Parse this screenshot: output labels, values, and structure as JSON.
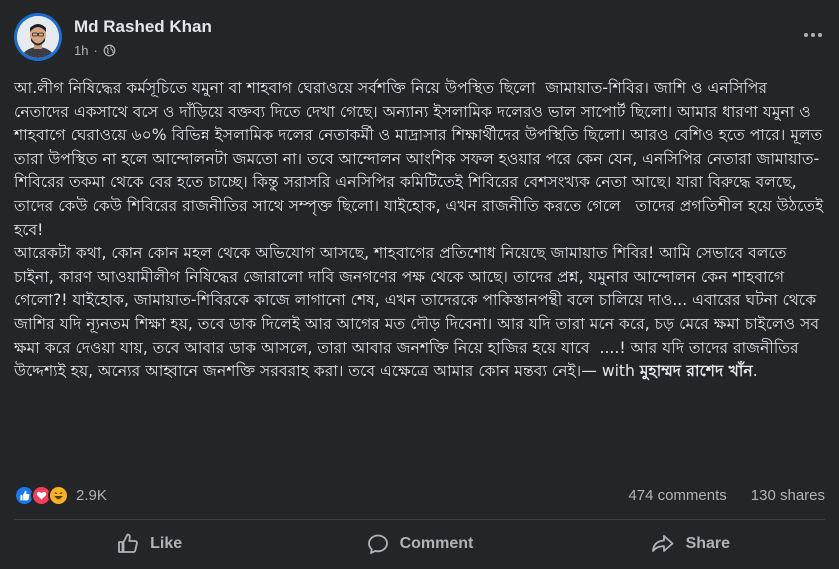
{
  "post": {
    "author": "Md Rashed Khan",
    "time": "1h",
    "separator": "·",
    "paragraphs": [
      "আ.লীগ নিষিদ্ধের কর্মসূচিতে যমুনা বা শাহবাগ ঘেরাওয়ে সর্বশক্তি নিয়ে উপস্থিত ছিলো  জামায়াত-শিবির। জাশি ও এনসিপির নেতাদের একসাথে বসে ও দাঁড়িয়ে বক্তব্য দিতে দেখা গেছে। অন্যান্য ইসলামিক দলেরও ভাল সাপোর্ট ছিলো। আমার ধারণা যমুনা ও শাহবাগে ঘেরাওয়ে ৬০% বিভিন্ন ইসলামিক দলের নেতাকর্মী ও মাদ্রাসার শিক্ষার্থীদের উপস্থিতি ছিলো। আরও বেশিও হতে পারে। মূলত তারা উপস্থিত না হলে আন্দোলনটা জমতো না। তবে আন্দোলন আংশিক সফল হওয়ার পরে কেন যেন, এনসিপির নেতারা জামায়াত-শিবিরের তকমা থেকে বের হতে চাচ্ছে। কিন্তু সরাসরি এনসিপির কমিটিতেই শিবিরের বেশসংখ্যক নেতা আছে। যারা বিরুদ্ধে বলছে, তাদের কেউ কেউ শিবিরের রাজনীতির সাথে সম্পৃক্ত ছিলো। যাইহোক, এখন রাজনীতি করতে গেলে   তাদের প্রগতিশীল হয়ে উঠতেই হবে!",
      "আরেকটা কথা, কোন কোন মহল থেকে অভিযোগ আসছে, শাহবাগের প্রতিশোধ নিয়েছে জামায়াত শিবির! আমি সেভাবে বলতে চাইনা, কারণ আওয়ামীলীগ নিষিদ্ধের জোরালো দাবি জনগণের পক্ষ থেকে আছে। তাদের প্রশ্ন, যমুনার আন্দোলন কেন শাহবাগে গেলো?! যাইহোক, জামায়াত-শিবিরকে কাজে লাগানো শেষ, এখন তাদেরকে পাকিস্তানপন্থী বলে চালিয়ে দাও... এবারের ঘটনা থেকে জাশির যদি ন্যূনতম শিক্ষা হয়, তবে ডাক দিলেই আর আগের মত দৌড় দিবেনা। আর যদি তারা মনে করে, চড় মেরে ক্ষমা চাইলেও সব ক্ষমা করে দেওয়া যায়, তবে আবার ডাক আসলে, তারা আবার জনশক্তি নিয়ে হাজির হয়ে যাবে  ....! আর যদি তাদের রাজনীতির উদ্দেশ্যই হয়, অন্যের আহ্বানে জনশক্তি সরবরাহ করা। তবে এক্ষেত্রে আমার কোন মন্তব্য নেই।"
    ],
    "with_prefix": "— with ",
    "tagged_name": "মুহাম্মদ রাশেদ খাঁন",
    "tagged_suffix": "."
  },
  "stats": {
    "reaction_count": "2.9K",
    "comments": "474 comments",
    "shares": "130 shares"
  },
  "actions": {
    "like": "Like",
    "comment": "Comment",
    "share": "Share"
  },
  "icons": {
    "globe": "globe-icon",
    "more": "more-horizontal-icon",
    "like": "thumbs-up-icon",
    "comment": "speech-bubble-icon",
    "share": "share-arrow-icon"
  },
  "colors": {
    "background": "#242526",
    "text": "#e4e6eb",
    "muted": "#b0b3b8",
    "avatar_ring": "#1c6ed2",
    "like_blue": "#1877f2",
    "love_red": "#f33e58",
    "haha_yellow": "#f7b125"
  }
}
